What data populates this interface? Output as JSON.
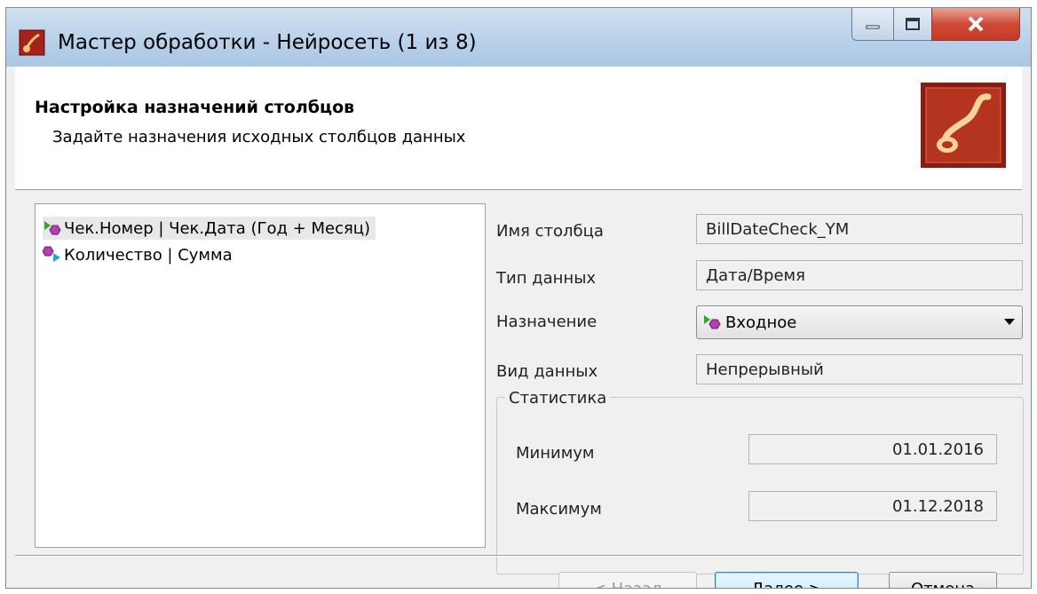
{
  "window": {
    "title": "Мастер обработки - Нейросеть (1 из 8)",
    "icon": "app-logo-icon",
    "controls": [
      "minimize-icon",
      "maximize-icon",
      "close-icon"
    ]
  },
  "header": {
    "title": "Настройка назначений столбцов",
    "subtitle": "Задайте назначения исходных столбцов данных",
    "logo": "deductor-logo-icon"
  },
  "columns_list": {
    "items": [
      {
        "label": "Чек.Номер | Чек.Дата (Год + Месяц)",
        "icon": "input-column-icon",
        "selected": true
      },
      {
        "label": "Количество | Сумма",
        "icon": "output-column-icon",
        "selected": false
      }
    ]
  },
  "properties": {
    "column_name_label": "Имя столбца",
    "column_name_value": "BillDateCheck_YM",
    "data_type_label": "Тип данных",
    "data_type_value": "Дата/Время",
    "purpose_label": "Назначение",
    "purpose_value": "Входное",
    "data_kind_label": "Вид данных",
    "data_kind_value": "Непрерывный"
  },
  "statistics": {
    "legend": "Статистика",
    "min_label": "Минимум",
    "min_value": "01.01.2016",
    "max_label": "Максимум",
    "max_value": "01.12.2018"
  },
  "buttons": {
    "back": "< Назад",
    "next": "Далее >",
    "cancel": "Отмена"
  },
  "colors": {
    "title_bar": "#b9d1ea",
    "close_button": "#c23a24",
    "logo_bg": "#8b1a10",
    "default_button": "#3c7fb1"
  }
}
